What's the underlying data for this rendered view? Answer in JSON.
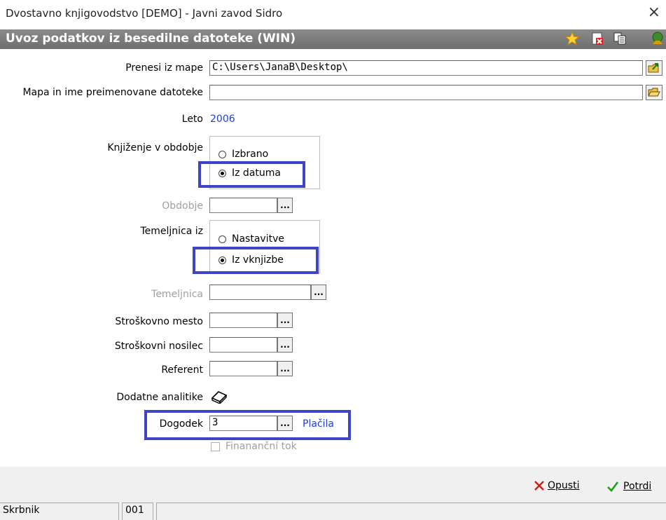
{
  "window": {
    "title": "Dvostavno knjigovodstvo [DEMO] - Javni zavod Sidro",
    "close_glyph": "×"
  },
  "form": {
    "title": "Uvoz podatkov iz besedilne datoteke (WIN)",
    "toolbar_icons": [
      "star-icon",
      "document-delete-icon",
      "copy-icon",
      "exit-icon"
    ]
  },
  "fields": {
    "prenesi_label": "Prenesi iz mape",
    "prenesi_value": "C:\\Users\\JanaB\\Desktop\\",
    "mapa_label": "Mapa in ime preimenovane datoteke",
    "mapa_value": "",
    "leto_label": "Leto",
    "leto_value": "2006",
    "knjizenje_label": "Knjiženje v obdobje",
    "knjizenje_options": [
      "Izbrano",
      "Iz datuma"
    ],
    "knjizenje_selected": "Iz datuma",
    "obdobje_label": "Obdobje",
    "obdobje_value": "",
    "temeljnica_iz_label": "Temeljnica iz",
    "temeljnica_iz_options": [
      "Nastavitve",
      "Iz vknjizbe"
    ],
    "temeljnica_iz_selected": "Iz vknjizbe",
    "temeljnica_label": "Temeljnica",
    "temeljnica_value": "",
    "stroskovno_mesto_label": "Stroškovno mesto",
    "stroskovno_mesto_value": "",
    "stroskovni_nosilec_label": "Stroškovni nosilec",
    "stroskovni_nosilec_value": "",
    "referent_label": "Referent",
    "referent_value": "",
    "dodatne_label": "Dodatne analitike",
    "dogodek_label": "Dogodek",
    "dogodek_value": "3",
    "dogodek_desc": "Plačila",
    "financni_tok_label": "Finananční tok",
    "browse_glyph": "..."
  },
  "buttons": {
    "opusti": "Opusti",
    "potrdi": "Potrdi"
  },
  "status": {
    "user": "Skrbnik",
    "code": "001",
    "extra": ""
  },
  "colors": {
    "highlight": "#3f44c4",
    "link": "#1d3fd8",
    "header": "#7a7a7a"
  }
}
